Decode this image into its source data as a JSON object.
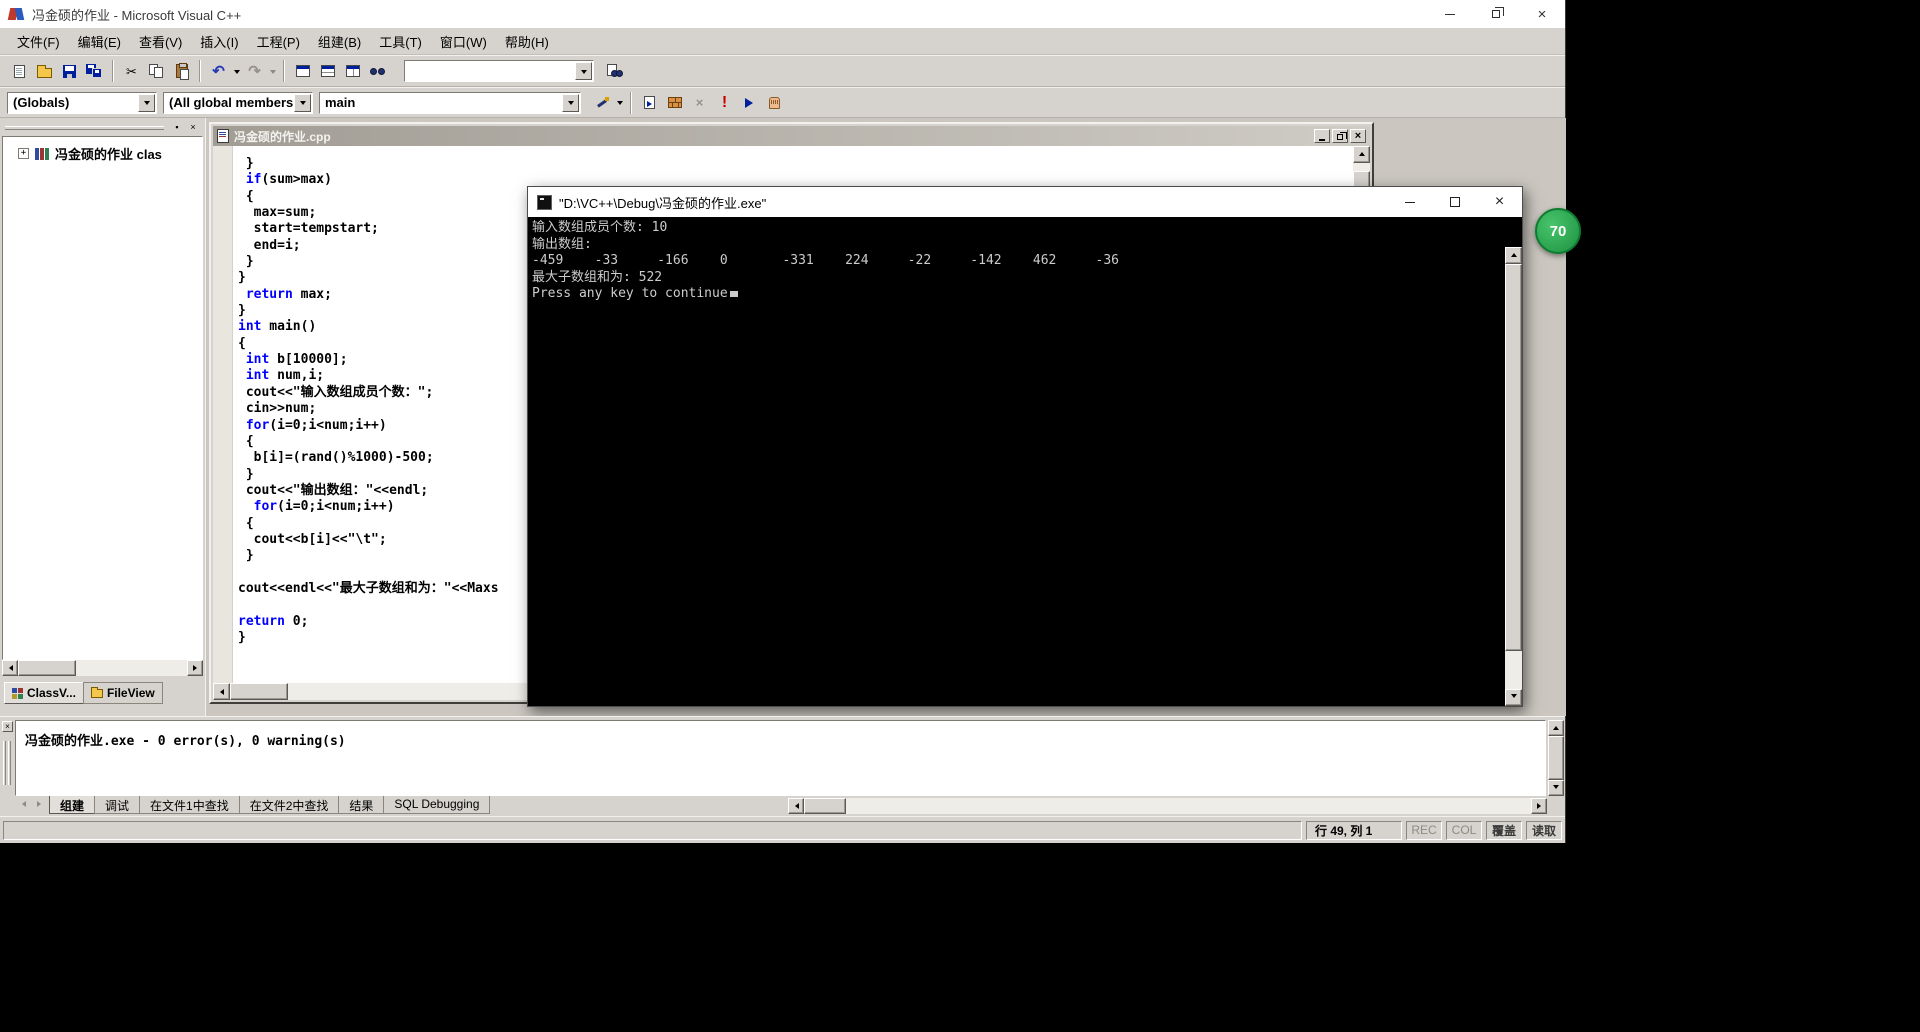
{
  "app": {
    "title": "冯金硕的作业 - Microsoft Visual C++"
  },
  "menu_bar": {
    "items": [
      {
        "name": "file",
        "label": "文件(F)"
      },
      {
        "name": "edit",
        "label": "编辑(E)"
      },
      {
        "name": "view",
        "label": "查看(V)"
      },
      {
        "name": "insert",
        "label": "插入(I)"
      },
      {
        "name": "project",
        "label": "工程(P)"
      },
      {
        "name": "build",
        "label": "组建(B)"
      },
      {
        "name": "tools",
        "label": "工具(T)"
      },
      {
        "name": "window",
        "label": "窗口(W)"
      },
      {
        "name": "help",
        "label": "帮助(H)"
      }
    ]
  },
  "standard_toolbar": {
    "find_value": ""
  },
  "wizard_bar": {
    "class_combo": "(Globals)",
    "filter_combo": "(All global members)",
    "member_combo": "main"
  },
  "workspace": {
    "root_label": "冯金硕的作业 clas",
    "tabs": [
      {
        "label": "ClassV...",
        "selected": true
      },
      {
        "label": "FileView",
        "selected": false
      }
    ]
  },
  "editor": {
    "title": "冯金硕的作业.cpp",
    "keyword_color": "#0000ff",
    "lines": [
      [
        [
          "t",
          " }"
        ]
      ],
      [
        [
          "t",
          " "
        ],
        [
          "k",
          "if"
        ],
        [
          "t",
          "(sum>max)"
        ]
      ],
      [
        [
          "t",
          " {"
        ]
      ],
      [
        [
          "t",
          "  max=sum;"
        ]
      ],
      [
        [
          "t",
          "  start=tempstart;"
        ]
      ],
      [
        [
          "t",
          "  end=i;"
        ]
      ],
      [
        [
          "t",
          " }"
        ]
      ],
      [
        [
          "t",
          "}"
        ]
      ],
      [
        [
          "t",
          " "
        ],
        [
          "k",
          "return"
        ],
        [
          "t",
          " max;"
        ]
      ],
      [
        [
          "t",
          "}"
        ]
      ],
      [
        [
          "k",
          "int"
        ],
        [
          "t",
          " main()"
        ]
      ],
      [
        [
          "t",
          "{"
        ]
      ],
      [
        [
          "t",
          " "
        ],
        [
          "k",
          "int"
        ],
        [
          "t",
          " b[10000];"
        ]
      ],
      [
        [
          "t",
          " "
        ],
        [
          "k",
          "int"
        ],
        [
          "t",
          " num,i;"
        ]
      ],
      [
        [
          "t",
          " cout<<\"输入数组成员个数：\";"
        ]
      ],
      [
        [
          "t",
          " cin>>num;"
        ]
      ],
      [
        [
          "t",
          " "
        ],
        [
          "k",
          "for"
        ],
        [
          "t",
          "(i=0;i<num;i++)"
        ]
      ],
      [
        [
          "t",
          " {"
        ]
      ],
      [
        [
          "t",
          "  b[i]=(rand()%1000)-500;"
        ]
      ],
      [
        [
          "t",
          " }"
        ]
      ],
      [
        [
          "t",
          " cout<<\"输出数组：\"<<endl;"
        ]
      ],
      [
        [
          "t",
          "  "
        ],
        [
          "k",
          "for"
        ],
        [
          "t",
          "(i=0;i<num;i++)"
        ]
      ],
      [
        [
          "t",
          " {"
        ]
      ],
      [
        [
          "t",
          "  cout<<b[i]<<\"\\t\";"
        ]
      ],
      [
        [
          "t",
          " }"
        ]
      ],
      [
        [
          "t",
          ""
        ]
      ],
      [
        [
          "t",
          "cout<<endl<<\"最大子数组和为：\"<<Maxs"
        ]
      ],
      [
        [
          "t",
          ""
        ]
      ],
      [
        [
          "k",
          "return"
        ],
        [
          "t",
          " 0;"
        ]
      ],
      [
        [
          "t",
          "}"
        ]
      ]
    ]
  },
  "console": {
    "title": "\"D:\\VC++\\Debug\\冯金硕的作业.exe\"",
    "lines": [
      "输入数组成员个数: 10",
      "输出数组:",
      "-459    -33     -166    0       -331    224     -22     -142    462     -36",
      "最大子数组和为: 522",
      "Press any key to continue"
    ]
  },
  "output": {
    "build_message": "冯金硕的作业.exe - 0 error(s), 0 warning(s)",
    "tabs": [
      {
        "name": "build",
        "label": "组建",
        "selected": true
      },
      {
        "name": "debug",
        "label": "调试",
        "selected": false
      },
      {
        "name": "find1",
        "label": "在文件1中查找",
        "selected": false
      },
      {
        "name": "find2",
        "label": "在文件2中查找",
        "selected": false
      },
      {
        "name": "results",
        "label": "结果",
        "selected": false
      },
      {
        "name": "sql",
        "label": "SQL Debugging",
        "selected": false
      }
    ]
  },
  "status_bar": {
    "position": "行 49, 列 1",
    "rec": "REC",
    "col": "COL",
    "ovr": "覆盖",
    "read": "读取"
  },
  "overlay_badge": {
    "value": "70",
    "color": "#1e9141"
  },
  "glyphs": {
    "cut": "✂",
    "undo": "↶",
    "redo": "↷",
    "execute": "!",
    "stop_build": "×",
    "tree_expand": "+",
    "close_small": "×",
    "pin": "▪"
  },
  "icons": {
    "new-file-icon": "blank page shape",
    "open-folder-icon": "yellow folder shape",
    "save-icon": "navy floppy shape",
    "save-all-icon": "two navy floppies",
    "scissors-icon": "unicode ✂",
    "copy-icon": "two pages shape",
    "paste-icon": "clipboard shape",
    "undo-icon": "unicode ↶",
    "redo-icon": "unicode ↷",
    "dropdown-icon": "css triangle down",
    "workspace-window-icon": "window shape",
    "output-window-icon": "window with split",
    "window-list-icon": "window with columns",
    "binoculars-icon": "two navy circles",
    "find-in-files-icon": "page with binoculars",
    "wand-icon": "navy wand with gold star",
    "compile-icon": "page with blue arrow",
    "build-icon": "brick wall shape",
    "stop-build-icon": "gray x",
    "execute-icon": "red exclamation",
    "go-icon": "blue arrow",
    "breakpoint-hand-icon": "tan hand shape",
    "scroll-arrow-icons": "css triangles up/down/left/right"
  }
}
